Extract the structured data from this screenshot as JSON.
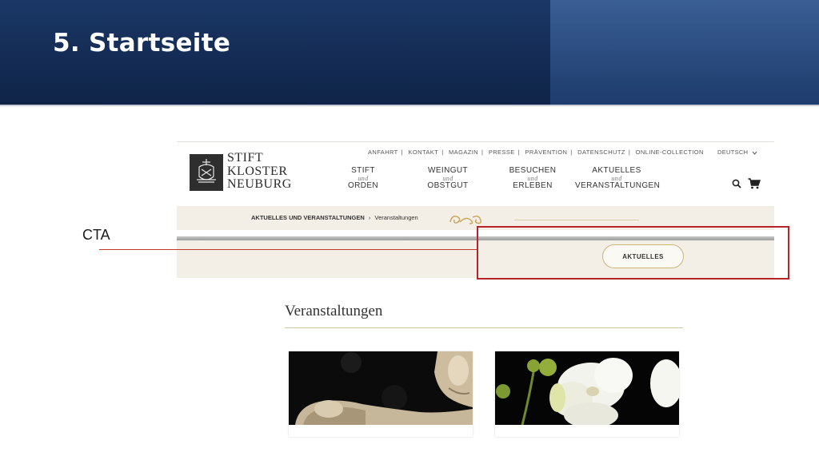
{
  "slide": {
    "title": "5.  Startseite"
  },
  "site": {
    "logo": {
      "line1": "STIFT",
      "line2": "KLOSTER",
      "line3": "NEUBURG"
    },
    "meta_nav": [
      "ANFAHRT",
      "KONTAKT",
      "MAGAZIN",
      "PRESSE",
      "PRÄVENTION",
      "DATENSCHUTZ",
      "ONLINE-COLLECTION"
    ],
    "meta_sep": "|",
    "language": "DEUTSCH",
    "main_nav": [
      {
        "top": "STIFT",
        "und": "und",
        "bottom": "ORDEN"
      },
      {
        "top": "WEINGUT",
        "und": "und",
        "bottom": "OBSTGUT"
      },
      {
        "top": "BESUCHEN",
        "und": "und",
        "bottom": "ERLEBEN"
      },
      {
        "top": "AKTUELLES",
        "und": "und",
        "bottom": "VERANSTALTUNGEN"
      }
    ],
    "breadcrumb": {
      "parent": "AKTUELLES UND VERANSTALTUNGEN",
      "sep": "›",
      "current": "Veranstaltungen"
    },
    "cta_button": "AKTUELLES"
  },
  "annotation": {
    "label": "CTA",
    "color": "#b5242a"
  },
  "section": {
    "title": "Veranstaltungen"
  },
  "icons": {
    "search": "search-icon",
    "cart": "cart-icon",
    "dropdown": "chevron-down-icon"
  }
}
